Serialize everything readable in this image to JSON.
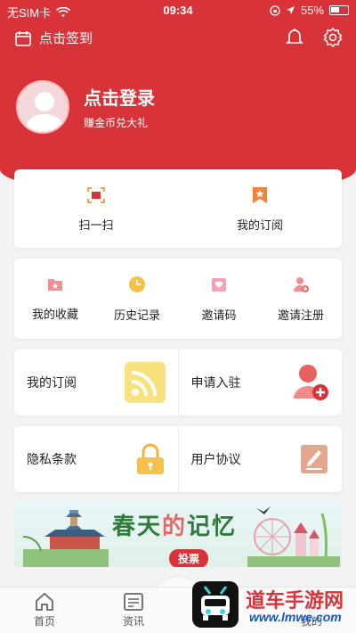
{
  "status": {
    "carrier": "无SIM卡",
    "time": "09:34",
    "battery": "55%"
  },
  "topbar": {
    "checkin": "点击签到"
  },
  "profile": {
    "name": "点击登录",
    "subtitle": "赚金币兑大礼"
  },
  "quick": [
    {
      "label": "扫一扫"
    },
    {
      "label": "我的订阅"
    }
  ],
  "grid": [
    {
      "label": "我的收藏"
    },
    {
      "label": "历史记录"
    },
    {
      "label": "邀请码"
    },
    {
      "label": "邀请注册"
    }
  ],
  "rows": [
    {
      "left": "我的订阅",
      "right": "申请入驻"
    },
    {
      "left": "隐私条款",
      "right": "用户协议"
    }
  ],
  "banner": {
    "title_a": "春天",
    "title_b": "的",
    "title_c": "记忆",
    "vote": "投票"
  },
  "tabs": [
    {
      "label": "首页"
    },
    {
      "label": "资讯"
    },
    {
      "label": ""
    },
    {
      "label": "我的"
    }
  ],
  "watermark": {
    "text": "道车手游网",
    "url": "www.lmwe.com"
  },
  "colors": {
    "brand_red": "#d9333a",
    "orange": "#f3a63a",
    "yellow": "#f6c04a",
    "pink": "#ef8fa0",
    "tan": "#e3a78f"
  }
}
